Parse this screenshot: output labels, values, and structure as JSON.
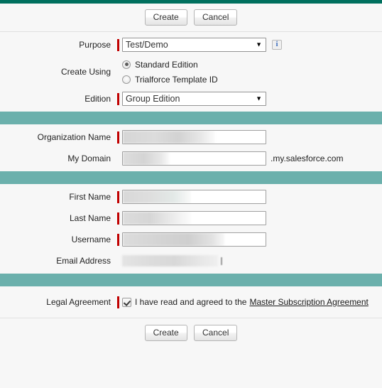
{
  "theme": {
    "accent_dark": "#00705E",
    "section_bar": "#6BB0AC",
    "required_marker": "#C00000",
    "background": "#F7F7F7",
    "link_color": "#1A1A1A"
  },
  "toolbar_top": {
    "create_label": "Create",
    "cancel_label": "Cancel"
  },
  "toolbar_bottom": {
    "create_label": "Create",
    "cancel_label": "Cancel"
  },
  "form": {
    "purpose": {
      "label": "Purpose",
      "value": "Test/Demo",
      "info_icon": "info-icon",
      "info_glyph": "i"
    },
    "create_using": {
      "label": "Create Using",
      "options": [
        {
          "label": "Standard Edition",
          "selected": true
        },
        {
          "label": "Trialforce Template ID",
          "selected": false
        }
      ]
    },
    "edition": {
      "label": "Edition",
      "value": "Group Edition"
    },
    "organization_name": {
      "label": "Organization Name",
      "value": ""
    },
    "my_domain": {
      "label": "My Domain",
      "value": "",
      "suffix": ".my.salesforce.com"
    },
    "first_name": {
      "label": "First Name",
      "value": ""
    },
    "last_name": {
      "label": "Last Name",
      "value": ""
    },
    "username": {
      "label": "Username",
      "value": ""
    },
    "email_address": {
      "label": "Email Address",
      "value": ""
    },
    "legal_agreement": {
      "label": "Legal Agreement",
      "checked": true,
      "text": "I have read and agreed to the",
      "link_text": "Master Subscription Agreement"
    }
  }
}
